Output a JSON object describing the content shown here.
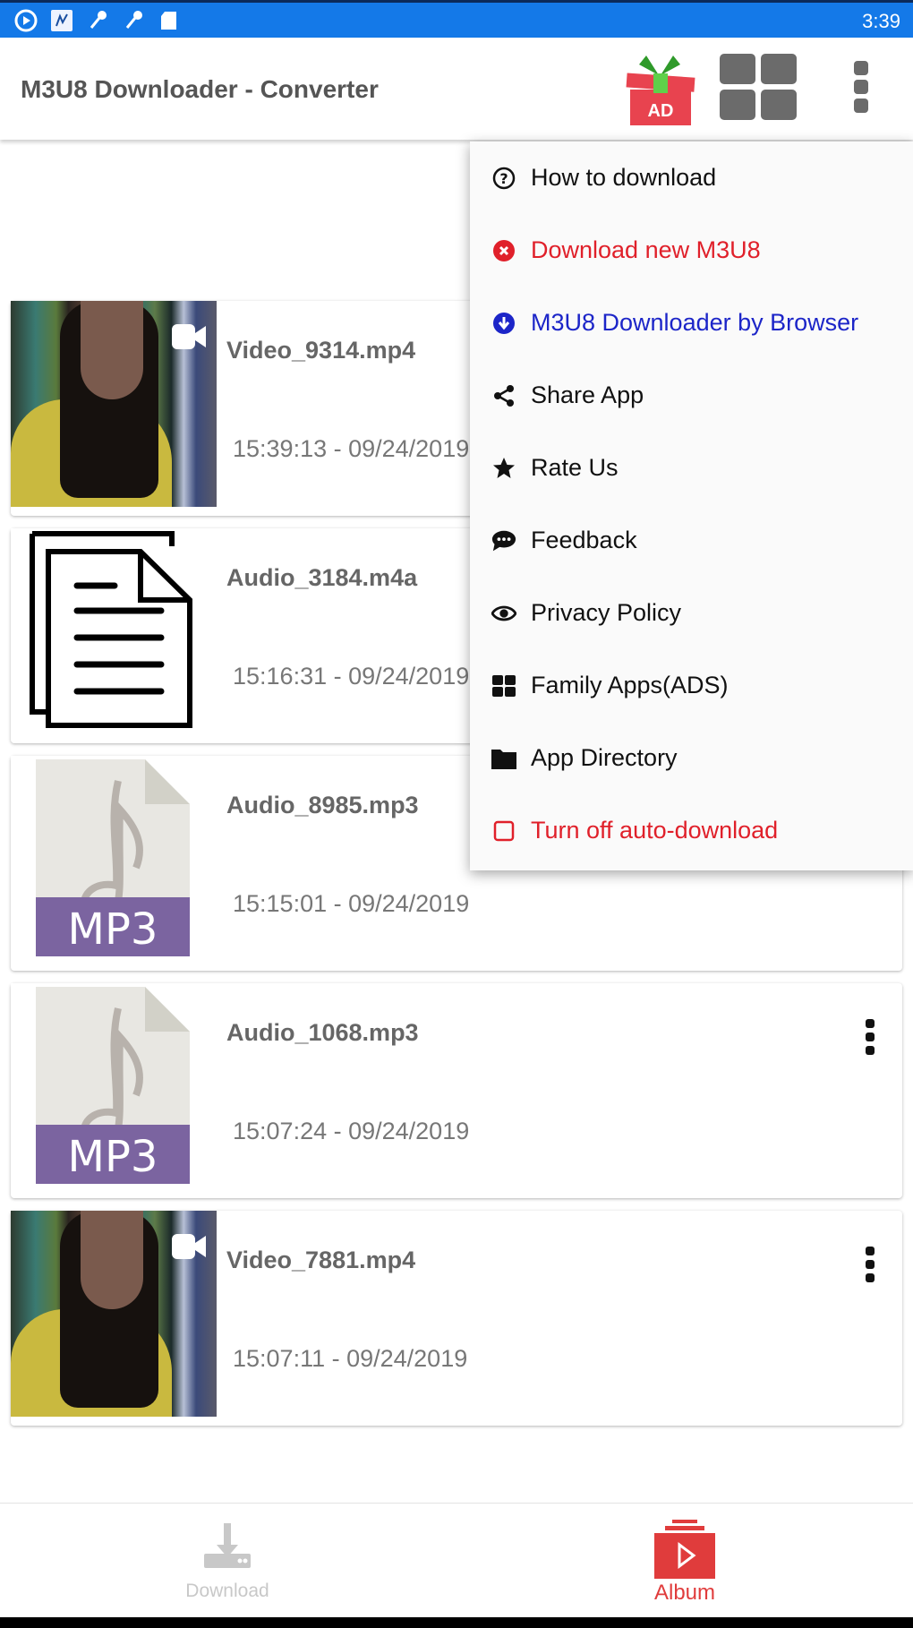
{
  "status_bar": {
    "time": "3:39",
    "icons": [
      "play-circle-icon",
      "app-notification-icon",
      "microphone-icon",
      "microphone-icon",
      "sd-card-icon"
    ]
  },
  "app_bar": {
    "title": "M3U8 Downloader - Converter",
    "ad_badge": "AD",
    "actions": [
      "gift-ad-icon",
      "grid-view-icon",
      "overflow-menu-icon"
    ]
  },
  "files": [
    {
      "name": "Video_9314.mp4",
      "time": "15:39:13 - 09/24/2019",
      "type": "video"
    },
    {
      "name": "Audio_3184.m4a",
      "time": "15:16:31 - 09/24/2019",
      "type": "document"
    },
    {
      "name": "Audio_8985.mp3",
      "time": "15:15:01 - 09/24/2019",
      "type": "mp3",
      "badge": "MP3"
    },
    {
      "name": "Audio_1068.mp3",
      "time": "15:07:24 - 09/24/2019",
      "type": "mp3",
      "badge": "MP3"
    },
    {
      "name": "Video_7881.mp4",
      "time": "15:07:11 - 09/24/2019",
      "type": "video"
    }
  ],
  "menu": {
    "items": [
      {
        "label": "How to download",
        "icon": "help-circle-icon",
        "color": "#111111"
      },
      {
        "label": "Download new M3U8",
        "icon": "close-circle-icon",
        "color": "#e0202a"
      },
      {
        "label": "M3U8 Downloader by Browser",
        "icon": "download-circle-icon",
        "color": "#1c25c8"
      },
      {
        "label": "Share App",
        "icon": "share-icon",
        "color": "#111111"
      },
      {
        "label": "Rate Us",
        "icon": "star-icon",
        "color": "#111111"
      },
      {
        "label": "Feedback",
        "icon": "chat-bubble-icon",
        "color": "#111111"
      },
      {
        "label": "Privacy Policy",
        "icon": "eye-icon",
        "color": "#111111"
      },
      {
        "label": "Family Apps(ADS)",
        "icon": "apps-grid-icon",
        "color": "#111111"
      },
      {
        "label": "App Directory",
        "icon": "folder-icon",
        "color": "#111111"
      },
      {
        "label": "Turn off auto-download",
        "icon": "checkbox-unchecked-icon",
        "color": "#e0202a",
        "checked": false
      }
    ]
  },
  "bottom_nav": {
    "tabs": [
      {
        "label": "Download",
        "icon": "download-icon",
        "active": false
      },
      {
        "label": "Album",
        "icon": "album-play-icon",
        "active": true
      }
    ],
    "active_color": "#e03c3c",
    "inactive_color": "#c8c8c8"
  },
  "colors": {
    "status_bar": "#1479e8",
    "mp3_badge": "#7b64a0",
    "ad_red": "#e8434f",
    "ad_green": "#4fc43a"
  }
}
